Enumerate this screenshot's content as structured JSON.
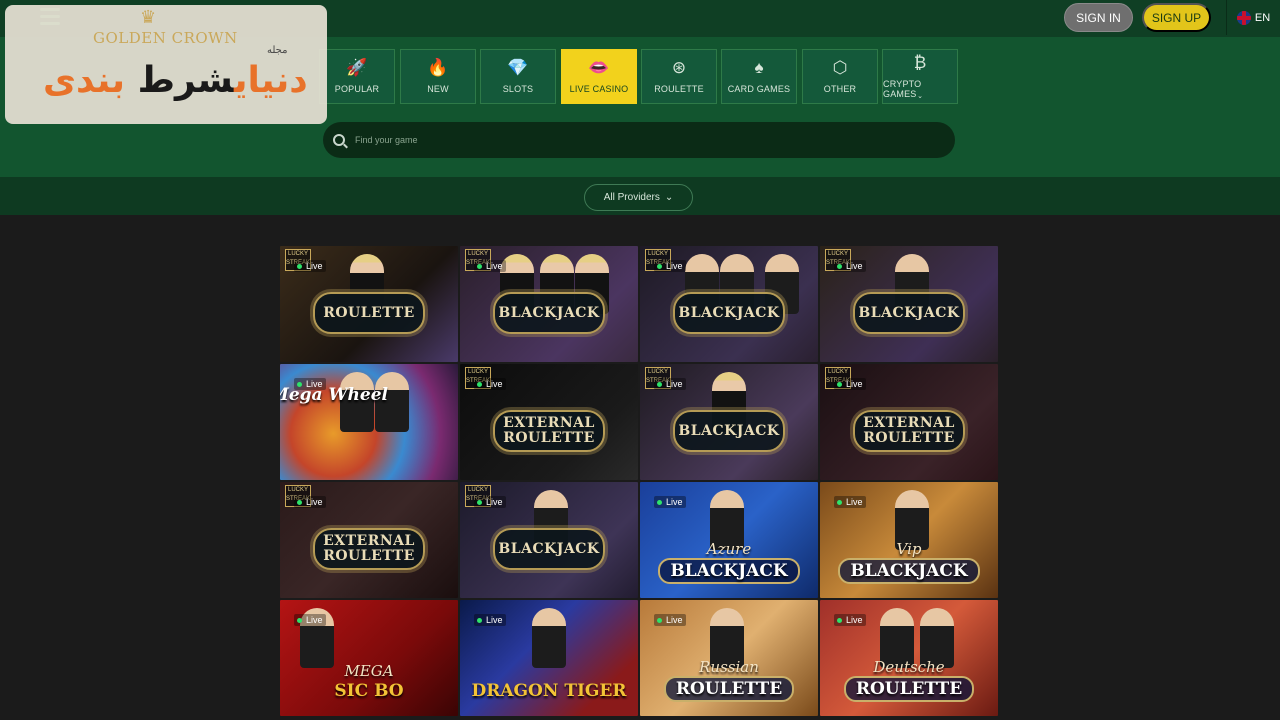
{
  "header": {
    "sign_in": "SIGN IN",
    "sign_up": "SIGN UP",
    "language": "EN",
    "menu_icon": "hamburger-icon"
  },
  "categories": [
    {
      "label": "POPULAR",
      "icon": "rocket-icon",
      "glyph": "🚀",
      "active": false
    },
    {
      "label": "NEW",
      "icon": "flame-icon",
      "glyph": "🔥",
      "active": false
    },
    {
      "label": "SLOTS",
      "icon": "diamond-icon",
      "glyph": "💎",
      "active": false
    },
    {
      "label": "LIVE CASINO",
      "icon": "lips-icon",
      "glyph": "👄",
      "active": true
    },
    {
      "label": "ROULETTE",
      "icon": "roulette-wheel-icon",
      "glyph": "⊛",
      "active": false
    },
    {
      "label": "CARD GAMES",
      "icon": "spade-icon",
      "glyph": "♠",
      "active": false
    },
    {
      "label": "OTHER",
      "icon": "cube-icon",
      "glyph": "⬡",
      "active": false
    },
    {
      "label": "CRYPTO GAMES",
      "icon": "bitcoin-icon",
      "glyph": "₿",
      "active": false,
      "has_dropdown": true
    }
  ],
  "search": {
    "placeholder": "Find your game"
  },
  "providers": {
    "label": "All Providers"
  },
  "live_label": "Live",
  "badge_label": "LUCKY STREAK",
  "games": [
    {
      "title": "ROULETTE",
      "style": "emblem",
      "badge": true
    },
    {
      "title": "BLACKJACK",
      "style": "emblem",
      "badge": true
    },
    {
      "title": "BLACKJACK",
      "style": "emblem",
      "badge": true
    },
    {
      "title": "BLACKJACK",
      "style": "emblem",
      "badge": true
    },
    {
      "title": "Mega Wheel",
      "style": "wheel",
      "badge": false
    },
    {
      "title": "EXTERNAL ROULETTE",
      "style": "emblem",
      "badge": true
    },
    {
      "title": "BLACKJACK",
      "style": "emblem",
      "badge": true
    },
    {
      "title": "EXTERNAL ROULETTE",
      "style": "emblem",
      "badge": true
    },
    {
      "title": "EXTERNAL ROULETTE",
      "style": "emblem",
      "badge": true
    },
    {
      "title": "BLACKJACK",
      "style": "emblem",
      "badge": true
    },
    {
      "title": "BLACKJACK",
      "subtitle": "Azure",
      "style": "big",
      "badge": false
    },
    {
      "title": "BLACKJACK",
      "subtitle": "Vip",
      "style": "big",
      "badge": false
    },
    {
      "title": "SIC BO",
      "subtitle": "MEGA",
      "style": "sicbo",
      "badge": false
    },
    {
      "title": "DRAGON TIGER",
      "style": "dragon",
      "badge": false
    },
    {
      "title": "ROULETTE",
      "subtitle": "Russian",
      "style": "big",
      "badge": false
    },
    {
      "title": "ROULETTE",
      "subtitle": "Deutsche",
      "style": "big",
      "badge": false
    }
  ],
  "watermark": {
    "brand": "GOLDEN CROWN",
    "magazine": "مجله",
    "title_orange": "دنیای",
    "title_black": "شرط",
    "title_orange_2": "بندی"
  }
}
